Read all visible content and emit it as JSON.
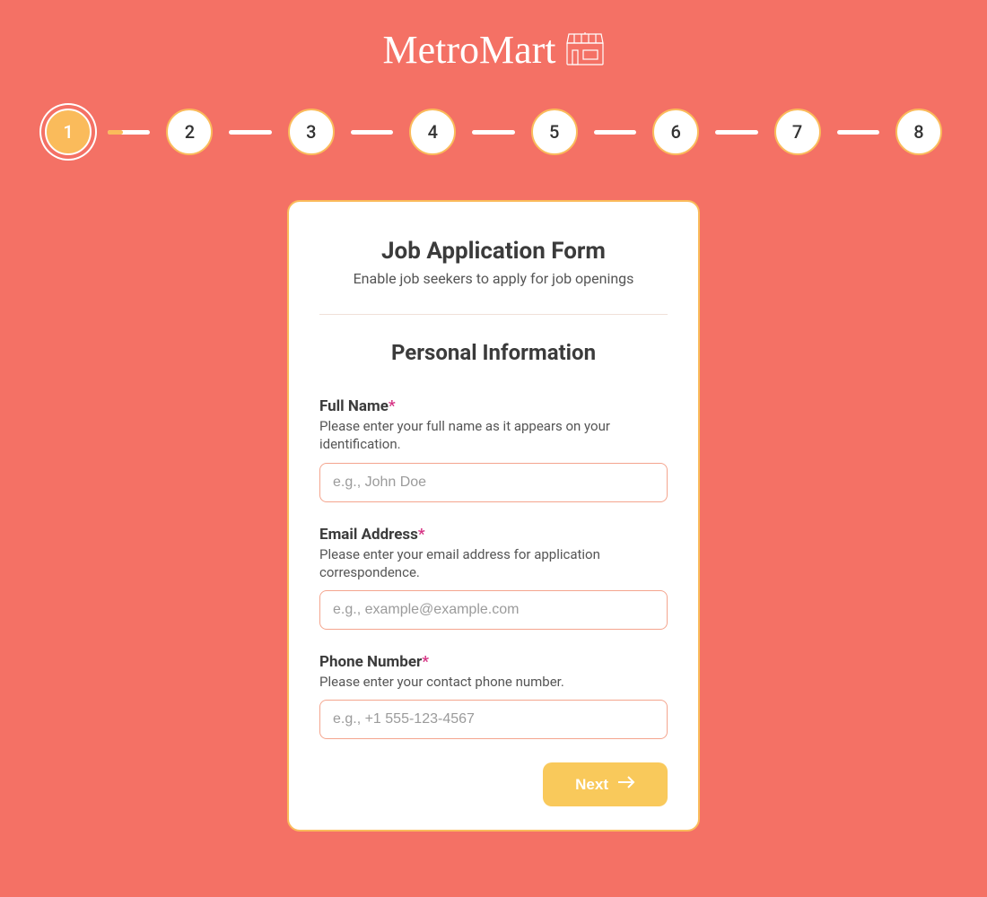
{
  "brand": {
    "name": "MetroMart"
  },
  "colors": {
    "background": "#f47165",
    "accent": "#fabb5b",
    "button": "#f9c95b",
    "input_border": "#f4a58e",
    "required": "#d63384"
  },
  "stepper": {
    "total": 8,
    "current": 1,
    "steps": [
      "1",
      "2",
      "3",
      "4",
      "5",
      "6",
      "7",
      "8"
    ],
    "first_connector_progress_pct": 35
  },
  "form": {
    "title": "Job Application Form",
    "subtitle": "Enable job seekers to apply for job openings",
    "section_title": "Personal Information",
    "fields": {
      "full_name": {
        "label": "Full Name",
        "required_mark": "*",
        "help": "Please enter your full name as it appears on your identification.",
        "placeholder": "e.g., John Doe",
        "value": ""
      },
      "email": {
        "label": "Email Address",
        "required_mark": "*",
        "help": "Please enter your email address for application correspondence.",
        "placeholder": "e.g., example@example.com",
        "value": ""
      },
      "phone": {
        "label": "Phone Number",
        "required_mark": "*",
        "help": "Please enter your contact phone number.",
        "placeholder": "e.g., +1 555-123-4567",
        "value": ""
      }
    },
    "next_button": "Next"
  }
}
